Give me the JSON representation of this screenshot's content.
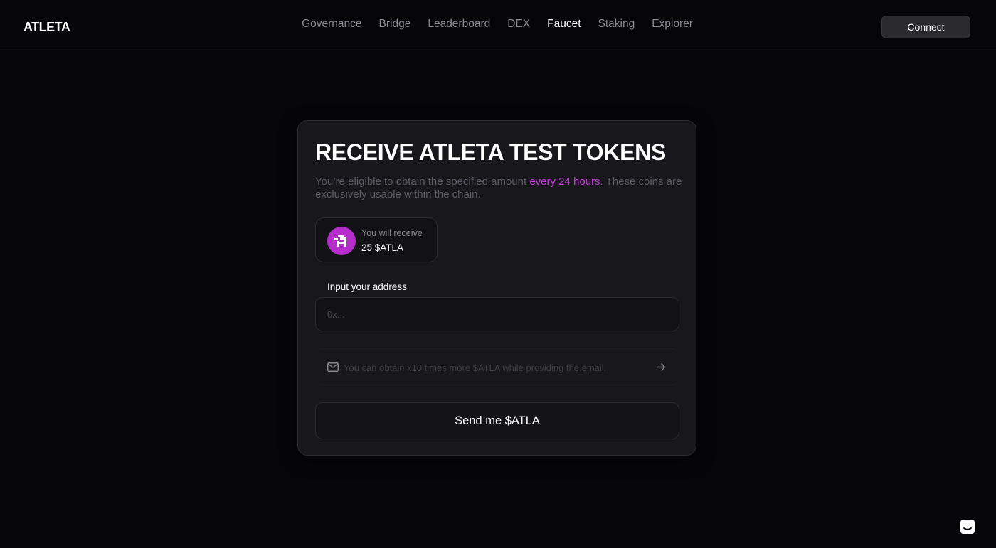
{
  "header": {
    "logo_text": "ATLETA",
    "nav": [
      {
        "label": "Governance",
        "active": false
      },
      {
        "label": "Bridge",
        "active": false
      },
      {
        "label": "Leaderboard",
        "active": false
      },
      {
        "label": "DEX",
        "active": false
      },
      {
        "label": "Faucet",
        "active": true
      },
      {
        "label": "Staking",
        "active": false
      },
      {
        "label": "Explorer",
        "active": false
      }
    ],
    "connect_label": "Connect"
  },
  "faucet": {
    "title": "RECEIVE ATLETA TEST TOKENS",
    "desc_before": "You’re eligible to obtain the specified amount ",
    "desc_highlight": "every 24 hours",
    "desc_after": ". These coins are exclusively usable within the chain.",
    "receive_label": "You will receive",
    "receive_amount": "25 $ATLA",
    "address_label": "Input your address",
    "address_placeholder": "0x...",
    "email_placeholder": "You can obtain x10 times more $ATLA while providing the email.",
    "send_label": "Send me $ATLA"
  },
  "colors": {
    "accent": "#c43bd9",
    "badge": "#b52ecb",
    "background": "#060609",
    "card": "#18181c"
  },
  "icons": {
    "token": "atleta-token-icon",
    "mail": "mail-icon",
    "arrow": "arrow-right-icon",
    "chat": "chat-icon"
  }
}
